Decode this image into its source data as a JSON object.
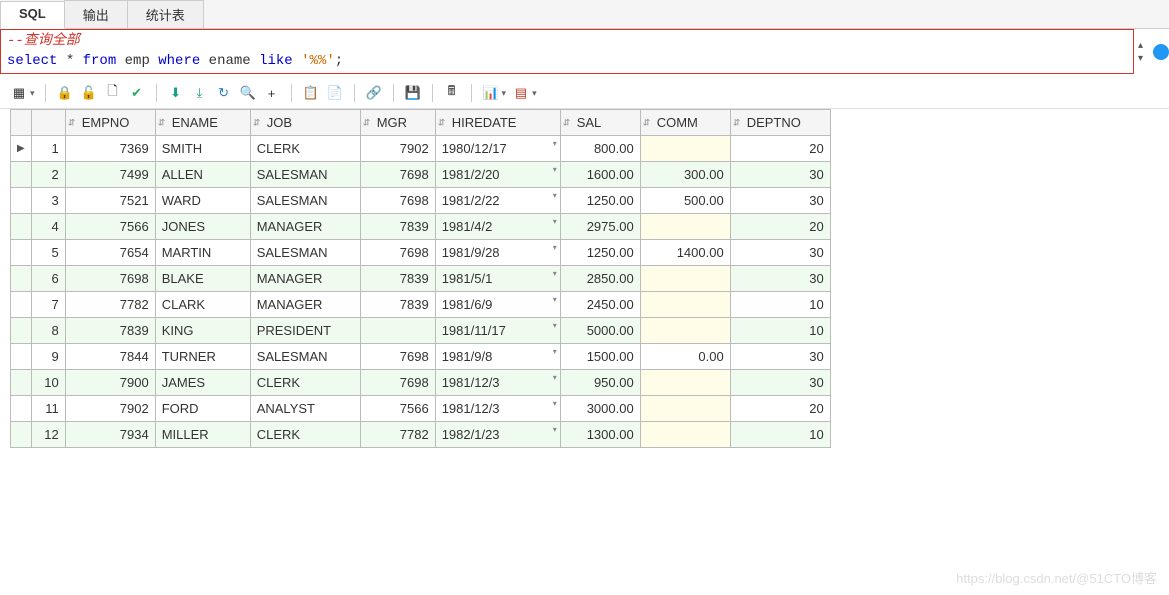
{
  "tabs": [
    "SQL",
    "输出",
    "统计表"
  ],
  "sql": {
    "comment": "--查询全部",
    "stmt_prefix": "select ",
    "star": "*",
    "from": " from ",
    "table": "emp ",
    "where": "where ",
    "col": "ename ",
    "like": "like ",
    "str": "'%%'",
    "semi": ";"
  },
  "toolbar": {
    "grid": "▦",
    "lock": "🔒",
    "unlock": "🔓",
    "new": "🗋",
    "check": "✔",
    "down": "⬇",
    "down2": "⤓",
    "refresh": "↻",
    "find": "🔍",
    "plus": "+",
    "export1": "📋",
    "export2": "📄",
    "link": "🔗",
    "save": "💾",
    "calc": "🖩",
    "chart": "📊",
    "table": "▤"
  },
  "columns": [
    "EMPNO",
    "ENAME",
    "JOB",
    "MGR",
    "HIREDATE",
    "SAL",
    "COMM",
    "DEPTNO"
  ],
  "rows": [
    {
      "n": 1,
      "EMPNO": "7369",
      "ENAME": "SMITH",
      "JOB": "CLERK",
      "MGR": "7902",
      "HIREDATE": "1980/12/17",
      "SAL": "800.00",
      "COMM": "",
      "DEPTNO": "20"
    },
    {
      "n": 2,
      "EMPNO": "7499",
      "ENAME": "ALLEN",
      "JOB": "SALESMAN",
      "MGR": "7698",
      "HIREDATE": "1981/2/20",
      "SAL": "1600.00",
      "COMM": "300.00",
      "DEPTNO": "30"
    },
    {
      "n": 3,
      "EMPNO": "7521",
      "ENAME": "WARD",
      "JOB": "SALESMAN",
      "MGR": "7698",
      "HIREDATE": "1981/2/22",
      "SAL": "1250.00",
      "COMM": "500.00",
      "DEPTNO": "30"
    },
    {
      "n": 4,
      "EMPNO": "7566",
      "ENAME": "JONES",
      "JOB": "MANAGER",
      "MGR": "7839",
      "HIREDATE": "1981/4/2",
      "SAL": "2975.00",
      "COMM": "",
      "DEPTNO": "20"
    },
    {
      "n": 5,
      "EMPNO": "7654",
      "ENAME": "MARTIN",
      "JOB": "SALESMAN",
      "MGR": "7698",
      "HIREDATE": "1981/9/28",
      "SAL": "1250.00",
      "COMM": "1400.00",
      "DEPTNO": "30"
    },
    {
      "n": 6,
      "EMPNO": "7698",
      "ENAME": "BLAKE",
      "JOB": "MANAGER",
      "MGR": "7839",
      "HIREDATE": "1981/5/1",
      "SAL": "2850.00",
      "COMM": "",
      "DEPTNO": "30"
    },
    {
      "n": 7,
      "EMPNO": "7782",
      "ENAME": "CLARK",
      "JOB": "MANAGER",
      "MGR": "7839",
      "HIREDATE": "1981/6/9",
      "SAL": "2450.00",
      "COMM": "",
      "DEPTNO": "10"
    },
    {
      "n": 8,
      "EMPNO": "7839",
      "ENAME": "KING",
      "JOB": "PRESIDENT",
      "MGR": "",
      "HIREDATE": "1981/11/17",
      "SAL": "5000.00",
      "COMM": "",
      "DEPTNO": "10"
    },
    {
      "n": 9,
      "EMPNO": "7844",
      "ENAME": "TURNER",
      "JOB": "SALESMAN",
      "MGR": "7698",
      "HIREDATE": "1981/9/8",
      "SAL": "1500.00",
      "COMM": "0.00",
      "DEPTNO": "30"
    },
    {
      "n": 10,
      "EMPNO": "7900",
      "ENAME": "JAMES",
      "JOB": "CLERK",
      "MGR": "7698",
      "HIREDATE": "1981/12/3",
      "SAL": "950.00",
      "COMM": "",
      "DEPTNO": "30"
    },
    {
      "n": 11,
      "EMPNO": "7902",
      "ENAME": "FORD",
      "JOB": "ANALYST",
      "MGR": "7566",
      "HIREDATE": "1981/12/3",
      "SAL": "3000.00",
      "COMM": "",
      "DEPTNO": "20"
    },
    {
      "n": 12,
      "EMPNO": "7934",
      "ENAME": "MILLER",
      "JOB": "CLERK",
      "MGR": "7782",
      "HIREDATE": "1982/1/23",
      "SAL": "1300.00",
      "COMM": "",
      "DEPTNO": "10"
    }
  ],
  "watermark": "https://blog.csdn.net/@51CTO博客"
}
